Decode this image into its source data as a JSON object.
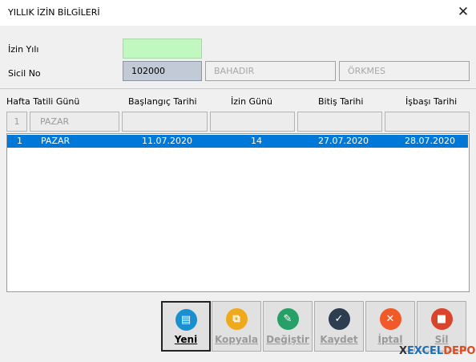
{
  "window": {
    "title": "YILLIK İZİN BİLGİLERİ",
    "close_glyph": "✕"
  },
  "form": {
    "izin_yili_label": "İzin Yılı",
    "izin_yili_value": "",
    "sicil_no_label": "Sicil No",
    "sicil_no_value": "102000",
    "first_name": "BAHADIR",
    "last_name": "ÖRKMES"
  },
  "columns": [
    "Hafta Tatili Günü",
    "Başlangıç Tarihi",
    "İzin Günü",
    "Bitiş Tarihi",
    "İşbaşı Tarihi"
  ],
  "filter_row": {
    "index": "1",
    "day": "PAZAR"
  },
  "rows": [
    {
      "index": "1",
      "day": "PAZAR",
      "start": "11.07.2020",
      "days": "14",
      "end": "27.07.2020",
      "return": "28.07.2020"
    }
  ],
  "buttons": [
    {
      "label": "Yeni",
      "icon": "document-icon",
      "color": "#1a8fd0",
      "active": true
    },
    {
      "label": "Kopyala",
      "icon": "copy-icon",
      "color": "#f0a81c",
      "active": false
    },
    {
      "label": "Değiştir",
      "icon": "edit-icon",
      "color": "#27a067",
      "active": false
    },
    {
      "label": "Kaydet",
      "icon": "check-icon",
      "color": "#2c3e50",
      "active": false
    },
    {
      "label": "İptal",
      "icon": "cancel-icon",
      "color": "#ef5a28",
      "active": false
    },
    {
      "label": "Sil",
      "icon": "trash-icon",
      "color": "#d9442b",
      "active": false
    }
  ],
  "brand": {
    "x": "X",
    "excel": "EXCEL",
    "depo": "DEPO",
    "x_color": "#333333",
    "excel_color": "#1e6fb8",
    "depo_color": "#e04a1f"
  },
  "colors": {
    "selection": "#0078d7",
    "year_field": "#c0f8c0",
    "sicil_field": "#c2cad6"
  }
}
